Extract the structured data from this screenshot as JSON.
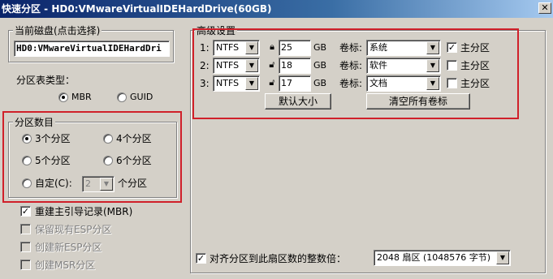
{
  "window": {
    "title": "快速分区 - HD0:VMwareVirtualIDEHardDrive(60GB)",
    "close_icon": "close-icon"
  },
  "disk": {
    "legend": "当前磁盘(点击选择)",
    "value": "HD0:VMwareVirtualIDEHardDri"
  },
  "partition_table": {
    "legend": "分区表类型：",
    "mbr": "MBR",
    "guid": "GUID",
    "selected": "MBR"
  },
  "partition_count": {
    "legend": "分区数目",
    "opt3": "3个分区",
    "opt4": "4个分区",
    "opt5": "5个分区",
    "opt6": "6个分区",
    "custom": "自定(C):",
    "custom_value": "2",
    "custom_suffix": "个分区",
    "selected": "3个分区"
  },
  "options": {
    "rebuild_mbr": "重建主引导记录(MBR)",
    "keep_esp": "保留现有ESP分区",
    "create_esp": "创建新ESP分区",
    "create_msr": "创建MSR分区"
  },
  "advanced": {
    "legend": "高级设置",
    "rows": [
      {
        "index": "1:",
        "fs": "NTFS",
        "size": "25",
        "unit": "GB",
        "label_text": "卷标:",
        "volume": "系统",
        "primary_label": "主分区",
        "primary": true,
        "locked": true
      },
      {
        "index": "2:",
        "fs": "NTFS",
        "size": "18",
        "unit": "GB",
        "label_text": "卷标:",
        "volume": "软件",
        "primary_label": "主分区",
        "primary": false,
        "locked": false
      },
      {
        "index": "3:",
        "fs": "NTFS",
        "size": "17",
        "unit": "GB",
        "label_text": "卷标:",
        "volume": "文档",
        "primary_label": "主分区",
        "primary": false,
        "locked": false
      }
    ],
    "default_size_button": "默认大小",
    "clear_labels_button": "清空所有卷标"
  },
  "align": {
    "label": "对齐分区到此扇区数的整数倍：",
    "checked": true,
    "value": "2048 扇区 (1048576 字节)"
  },
  "highlight_color": "#d0202a"
}
